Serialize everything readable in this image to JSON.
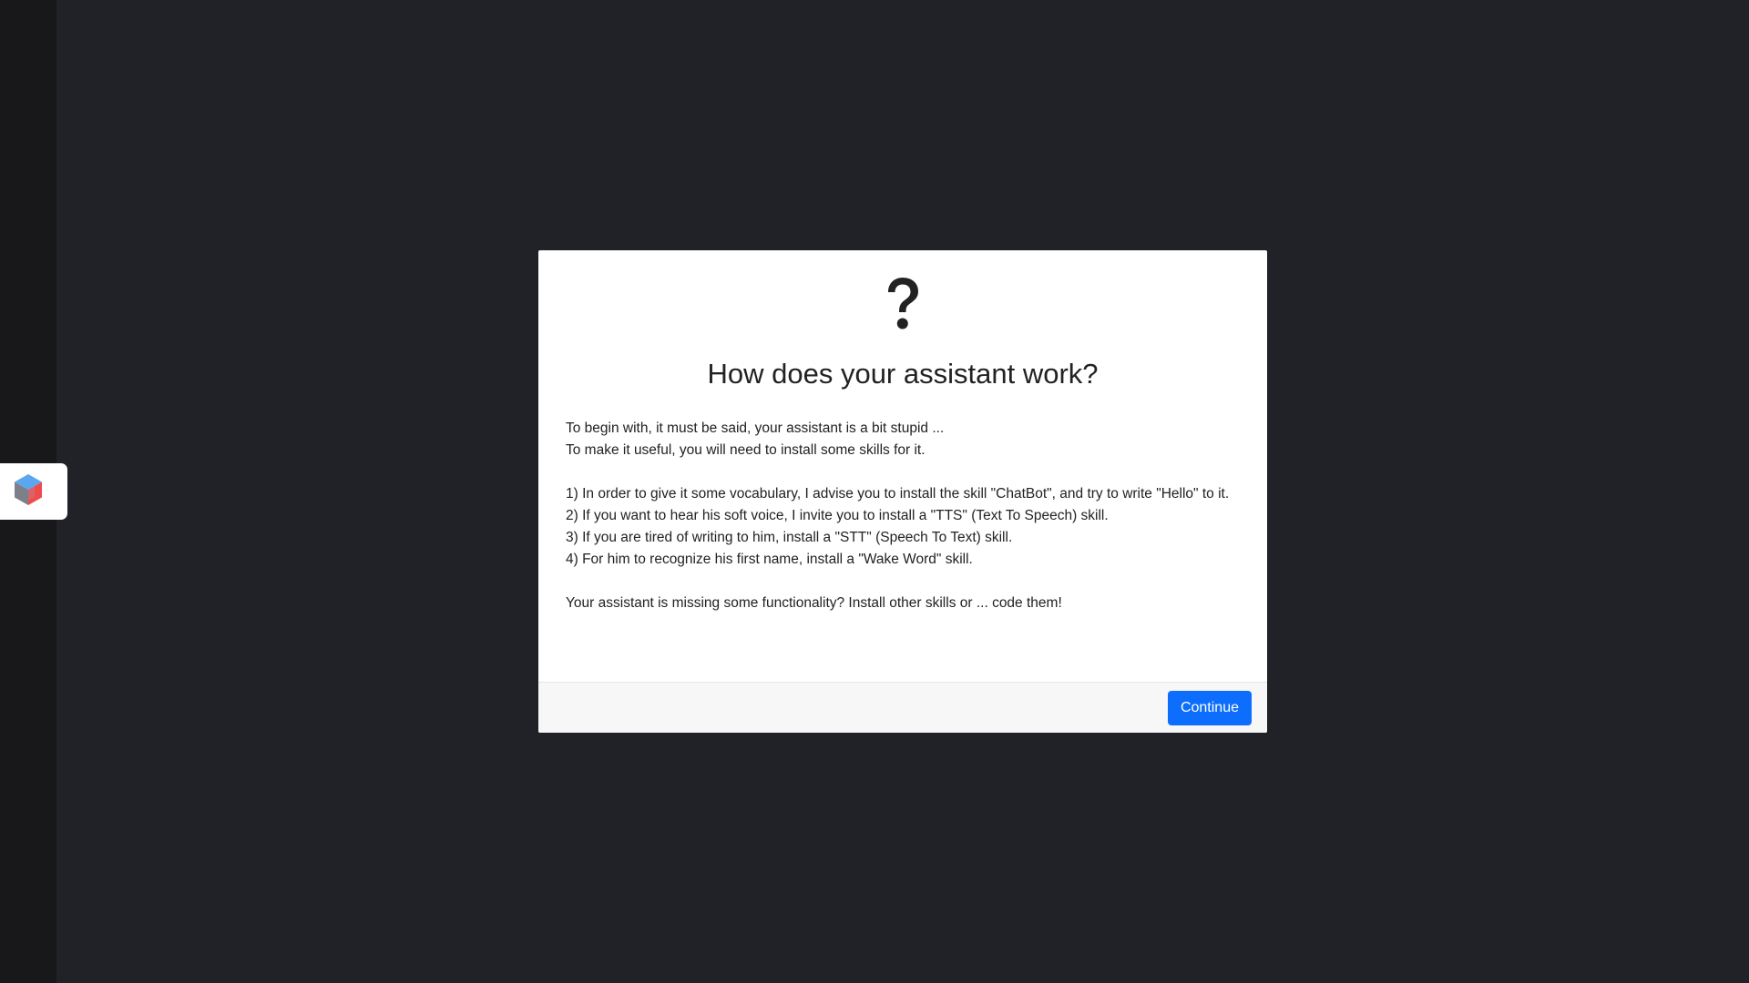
{
  "app": {
    "logo_icon": "hexagon-cube-logo-icon",
    "background_color": "#212227",
    "sidebar_color": "#18181b"
  },
  "modal": {
    "icon": "question-mark-icon",
    "title": "How does your assistant work?",
    "intro_lines": [
      "To begin with, it must be said, your assistant is a bit stupid ...",
      "To make it useful, you will need to install some skills for it."
    ],
    "steps": [
      "1) In order to give it some vocabulary, I advise you to install the skill \"ChatBot\", and try to write \"Hello\" to it.",
      "2) If you want to hear his soft voice, I invite you to install a \"TTS\" (Text To Speech) skill.",
      "3) If you are tired of writing to him, install a \"STT\" (Speech To Text) skill.",
      "4) For him to recognize his first name, install a \"Wake Word\" skill."
    ],
    "closing": "Your assistant is missing some functionality? Install other skills or ... code them!",
    "continue_label": "Continue",
    "accent_color": "#0d6efd"
  }
}
